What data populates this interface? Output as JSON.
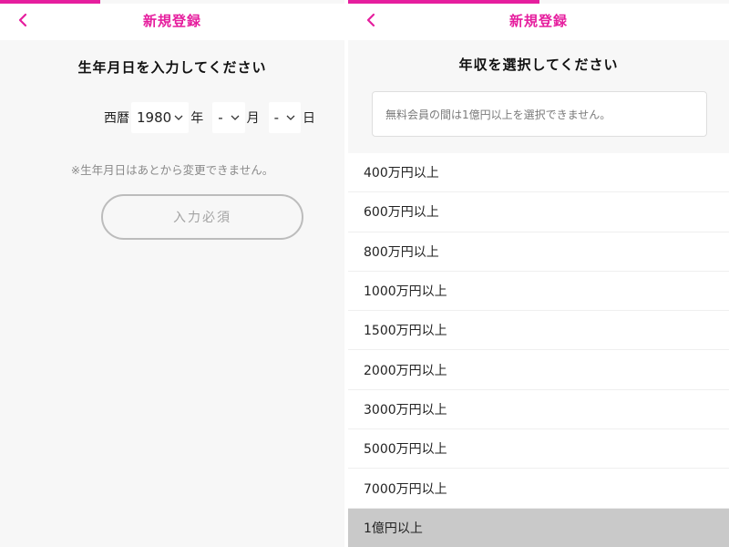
{
  "left": {
    "header": {
      "title": "新規登録"
    },
    "heading": "生年月日を入力してください",
    "dob": {
      "era_label": "西暦",
      "year_value": "1980",
      "year_suffix": "年",
      "month_value": "-",
      "month_suffix": "月",
      "day_value": "-",
      "day_suffix": "日"
    },
    "note": "※生年月日はあとから変更できません。",
    "submit_label": "入力必須"
  },
  "right": {
    "header": {
      "title": "新規登録"
    },
    "heading": "年収を選択してください",
    "notice": "無料会員の間は1億円以上を選択できません。",
    "options": [
      "400万円以上",
      "600万円以上",
      "800万円以上",
      "1000万円以上",
      "1500万円以上",
      "2000万円以上",
      "3000万円以上",
      "5000万円以上",
      "7000万円以上",
      "1億円以上"
    ]
  },
  "colors": {
    "accent": "#e61e9e",
    "disabled_bg": "#c9c9c9"
  },
  "icons": {
    "back": "chevron-left-icon",
    "dropdown": "chevron-down-icon"
  }
}
